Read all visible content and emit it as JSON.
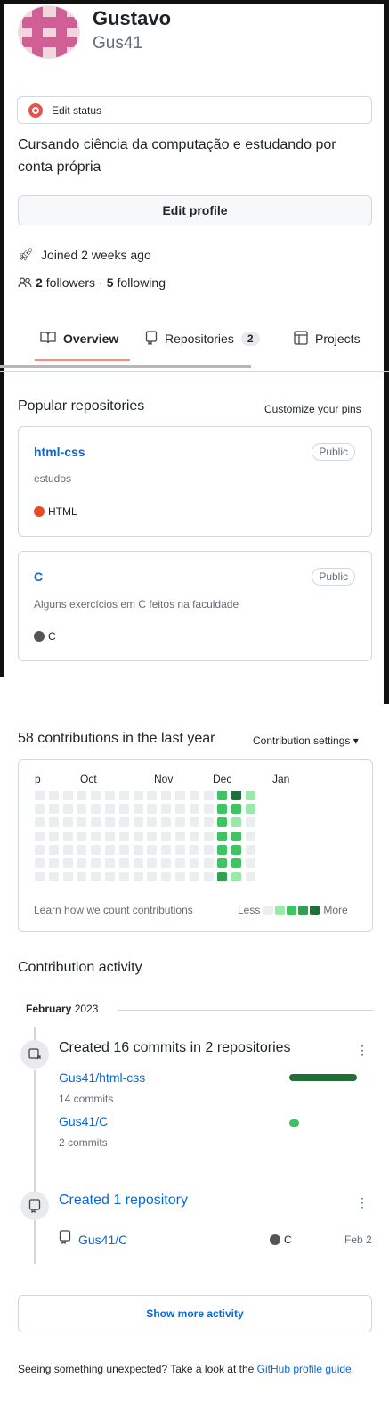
{
  "profile": {
    "name": "Gustavo",
    "login": "Gus41",
    "status_label": "Edit status",
    "bio": "Cursando ciência da computação e estudando por conta própria",
    "edit_button": "Edit profile",
    "joined": "Joined 2 weeks ago",
    "followers_count": "2",
    "followers_label": "followers",
    "separator": "·",
    "following_count": "5",
    "following_label": "following"
  },
  "tabs": [
    {
      "label": "Overview",
      "icon": "book-icon",
      "selected": true
    },
    {
      "label": "Repositories",
      "icon": "repo-icon",
      "counter": "2"
    },
    {
      "label": "Projects",
      "icon": "table-icon"
    }
  ],
  "popular": {
    "title": "Popular repositories",
    "customize": "Customize your pins",
    "repos": [
      {
        "name": "html-css",
        "visibility": "Public",
        "description": "estudos",
        "language": "HTML",
        "language_color": "#e34c26"
      },
      {
        "name": "C",
        "visibility": "Public",
        "description": "Alguns exercícios em C feitos na faculdade",
        "language": "C",
        "language_color": "#555555"
      }
    ]
  },
  "contributions": {
    "heading": "58 contributions in the last year",
    "settings": "Contribution settings ▾",
    "months": [
      "p",
      "Oct",
      "Nov",
      "Dec",
      "Jan"
    ],
    "learn": "Learn how we count contributions",
    "less": "Less",
    "more": "More",
    "levels_colors": [
      "#ebedf0",
      "#9be9a8",
      "#40c463",
      "#30a14e",
      "#216e39"
    ],
    "active_columns": [
      {
        "column": 13,
        "levels": [
          2,
          2,
          2,
          2,
          2,
          2,
          3
        ]
      },
      {
        "column": 14,
        "levels": [
          4,
          2,
          1,
          2,
          2,
          2,
          1
        ]
      },
      {
        "column": 15,
        "levels": [
          1,
          1,
          0,
          0,
          0,
          0,
          0
        ]
      }
    ]
  },
  "activity": {
    "heading": "Contribution activity",
    "month": "February",
    "year": "2023",
    "items": [
      {
        "title": "Created 16 commits in 2 repositories",
        "repos": [
          {
            "name": "Gus41/html-css",
            "commits": "14 commits",
            "share": 0.875
          },
          {
            "name": "Gus41/C",
            "commits": "2 commits",
            "share": 0.125
          }
        ]
      },
      {
        "title": "Created 1 repository",
        "repo": "Gus41/C",
        "language": "C",
        "date": "Feb 2"
      }
    ],
    "show_more": "Show more activity"
  },
  "footer": {
    "text": "Seeing something unexpected? Take a look at the ",
    "link": "GitHub profile guide",
    "end": "."
  }
}
